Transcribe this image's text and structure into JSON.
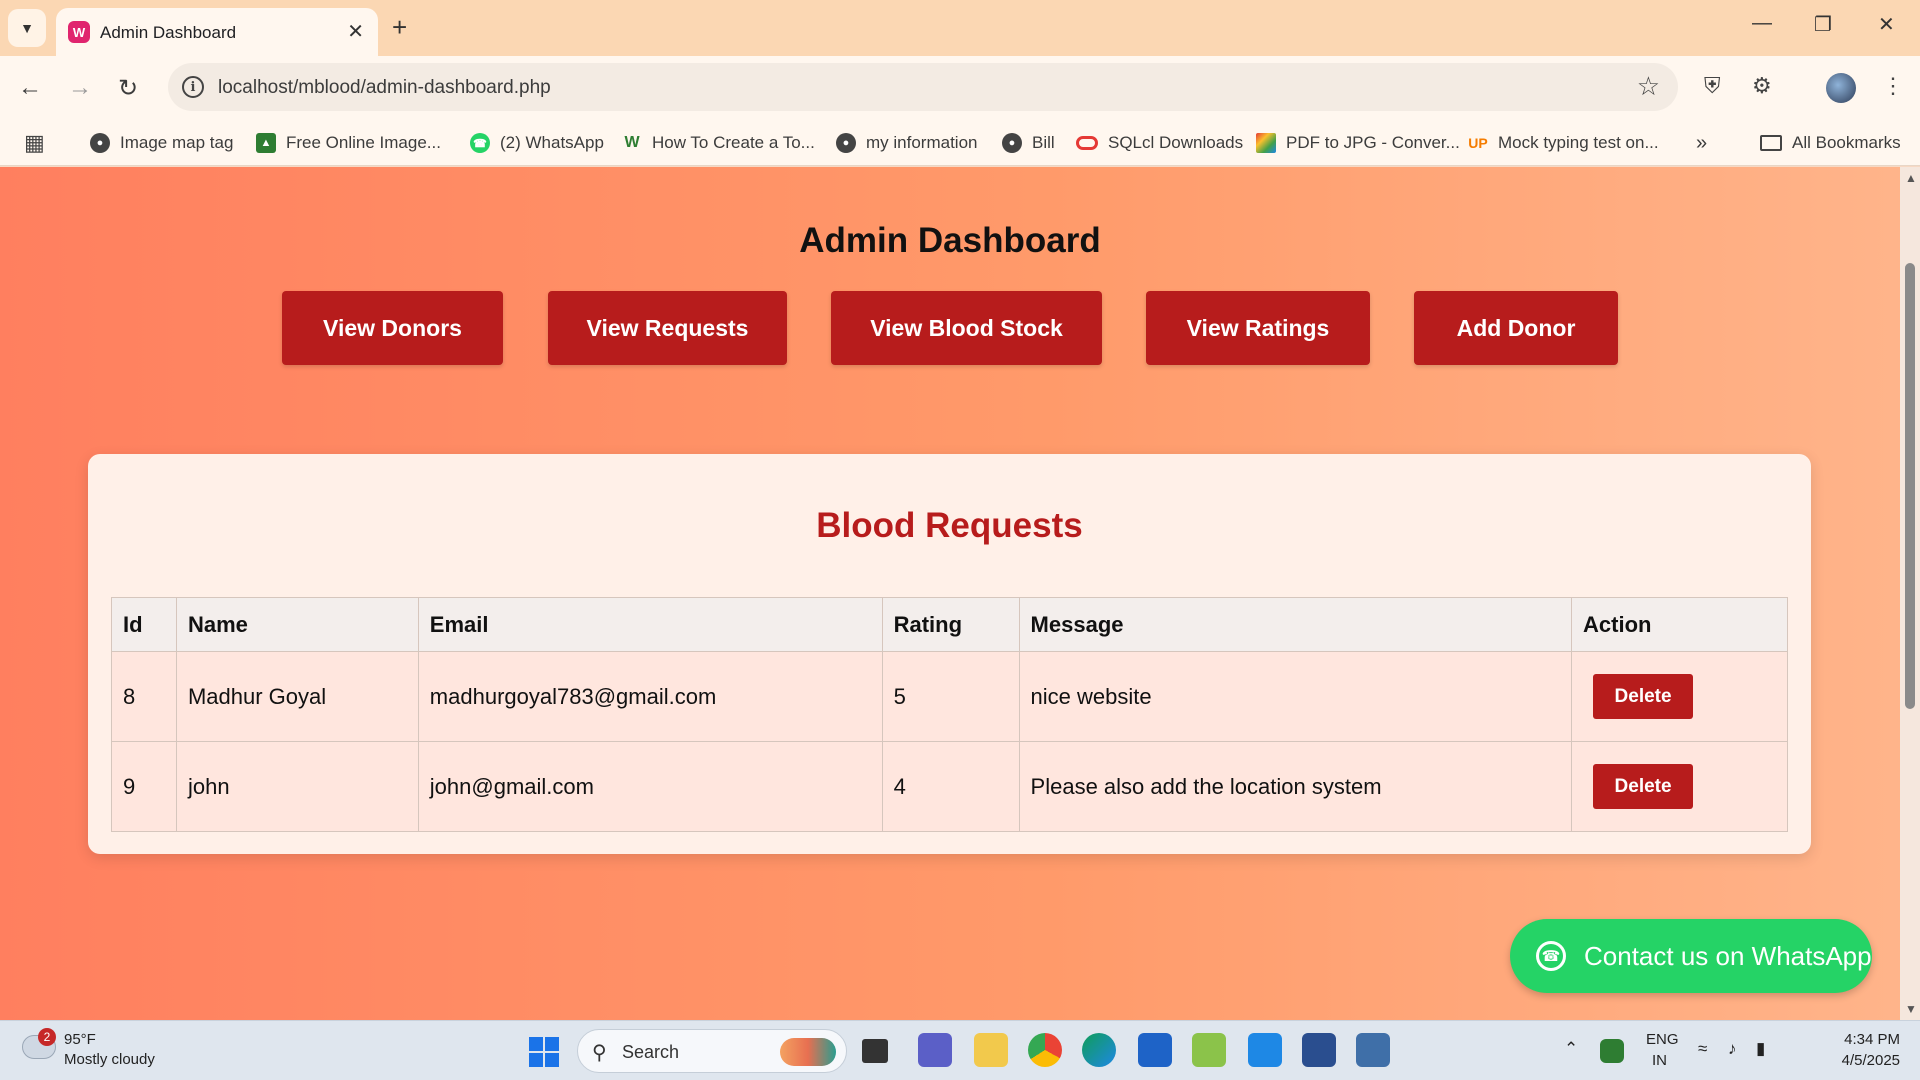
{
  "browser": {
    "tab_title": "Admin Dashboard",
    "tab_favicon": "W",
    "url": "localhost/mblood/admin-dashboard.php"
  },
  "bookmarks": [
    {
      "label": "Image map tag",
      "icon": "globe-icon"
    },
    {
      "label": "Free Online Image...",
      "icon": "image-icon"
    },
    {
      "label": "(2) WhatsApp",
      "icon": "whatsapp-icon"
    },
    {
      "label": "How To Create a To...",
      "icon": "w3-icon"
    },
    {
      "label": "my information",
      "icon": "globe-icon"
    },
    {
      "label": "Bill",
      "icon": "globe-icon"
    },
    {
      "label": "SQLcl Downloads",
      "icon": "oracle-icon"
    },
    {
      "label": "PDF to JPG - Conver...",
      "icon": "pdf-icon"
    },
    {
      "label": "Mock typing test on...",
      "icon": "up-icon"
    }
  ],
  "all_bookmarks": "All Bookmarks",
  "page": {
    "title": "Admin Dashboard",
    "nav_buttons": [
      "View Donors",
      "View Requests",
      "View Blood Stock",
      "View Ratings",
      "Add Donor"
    ],
    "section_title": "Blood Requests",
    "table": {
      "headers": [
        "Id",
        "Name",
        "Email",
        "Rating",
        "Message",
        "Action"
      ],
      "rows": [
        {
          "id": "8",
          "name": "Madhur Goyal",
          "email": "madhurgoyal783@gmail.com",
          "rating": "5",
          "message": "nice website",
          "action": "Delete"
        },
        {
          "id": "9",
          "name": "john",
          "email": "john@gmail.com",
          "rating": "4",
          "message": "Please also add the location system",
          "action": "Delete"
        }
      ]
    },
    "whatsapp_label": "Contact us on WhatsApp"
  },
  "taskbar": {
    "weather_badge": "2",
    "temperature": "95°F",
    "weather": "Mostly cloudy",
    "search_label": "Search",
    "lang_top": "ENG",
    "lang_bottom": "IN",
    "time": "4:34 PM",
    "date": "4/5/2025"
  },
  "colors": {
    "accent_red": "#b71c1c",
    "whatsapp_green": "#25d366",
    "page_gradient_start": "#ff7f5f",
    "page_gradient_end": "#ffb48a"
  }
}
